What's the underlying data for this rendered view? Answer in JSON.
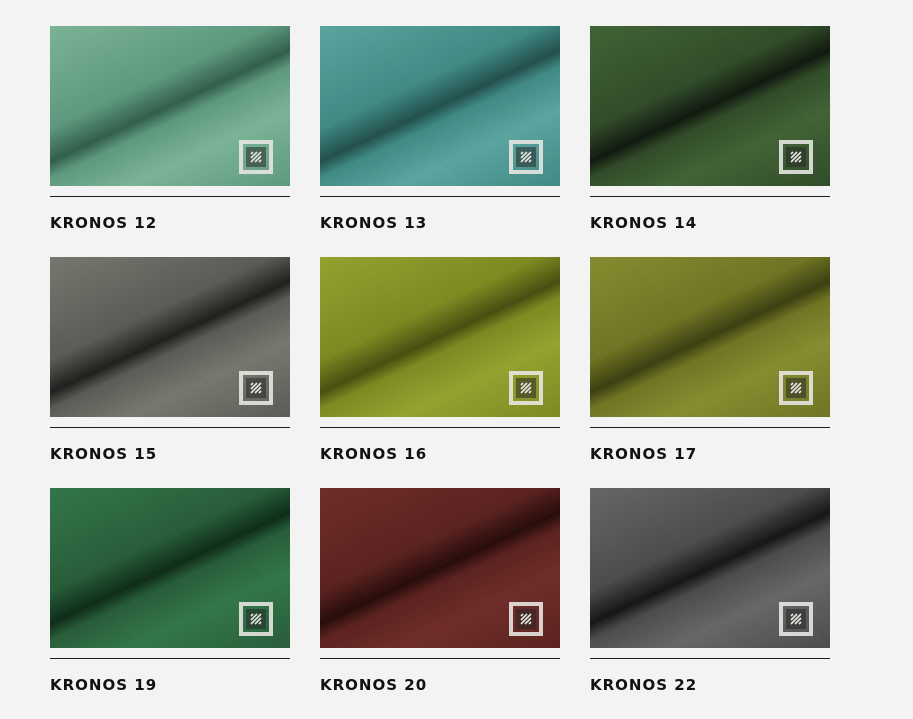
{
  "fabrics": [
    {
      "name": "KRONOS 12",
      "color": "#5c9a7e",
      "light": "#7bb597",
      "dark": "#2f5d48"
    },
    {
      "name": "KRONOS 13",
      "color": "#3e8a84",
      "light": "#5aa5a0",
      "dark": "#1f4e4b"
    },
    {
      "name": "KRONOS 14",
      "color": "#2e4a26",
      "light": "#3f6233",
      "dark": "#0d160b"
    },
    {
      "name": "KRONOS 15",
      "color": "#5a5a55",
      "light": "#77776f",
      "dark": "#1c1c1a"
    },
    {
      "name": "KRONOS 16",
      "color": "#7d8a1e",
      "light": "#95a32c",
      "dark": "#454d0c"
    },
    {
      "name": "KRONOS 17",
      "color": "#6f7420",
      "light": "#878c2d",
      "dark": "#3a3d0d"
    },
    {
      "name": "KRONOS 19",
      "color": "#245c36",
      "light": "#317548",
      "dark": "#0b2a15"
    },
    {
      "name": "KRONOS 20",
      "color": "#5a1f1c",
      "light": "#6e2a26",
      "dark": "#240807"
    },
    {
      "name": "KRONOS 22",
      "color": "#4a4a4a",
      "light": "#666666",
      "dark": "#121212"
    }
  ],
  "badge_icon": "fabric-texture-icon"
}
